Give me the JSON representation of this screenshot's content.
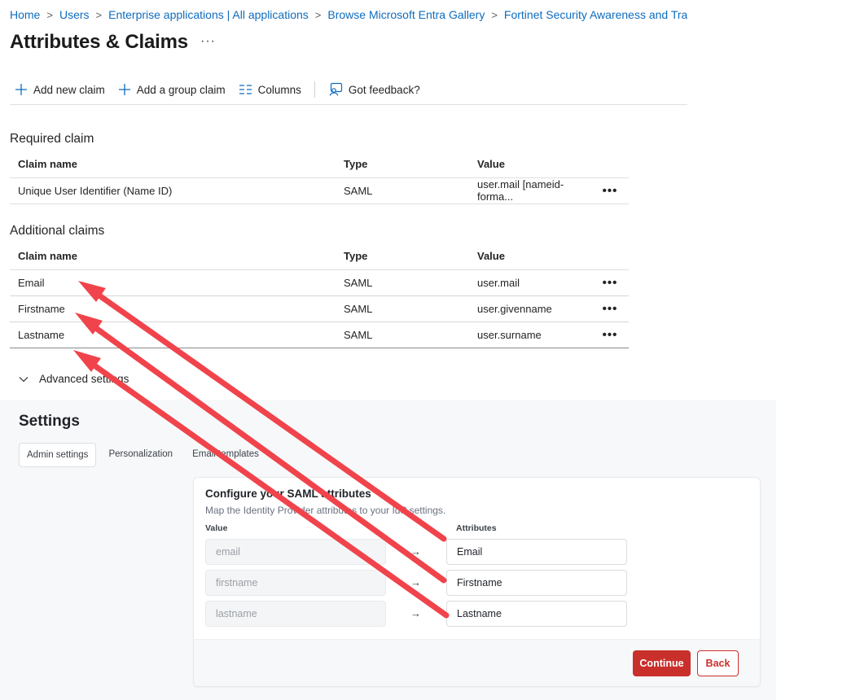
{
  "breadcrumb": [
    {
      "label": "Home"
    },
    {
      "label": "Users"
    },
    {
      "label": "Enterprise applications | All applications"
    },
    {
      "label": "Browse Microsoft Entra Gallery"
    },
    {
      "label": "Fortinet Security Awareness and Trainin"
    }
  ],
  "page": {
    "title": "Attributes & Claims",
    "more": "···"
  },
  "toolbar": {
    "add_new_claim": "Add new claim",
    "add_group_claim": "Add a group claim",
    "columns": "Columns",
    "feedback": "Got feedback?"
  },
  "required": {
    "title": "Required claim",
    "headers": {
      "name": "Claim name",
      "type": "Type",
      "value": "Value"
    },
    "rows": [
      {
        "name": "Unique User Identifier (Name ID)",
        "type": "SAML",
        "value": "user.mail [nameid-forma...",
        "more": "•••"
      }
    ]
  },
  "additional": {
    "title": "Additional claims",
    "headers": {
      "name": "Claim name",
      "type": "Type",
      "value": "Value"
    },
    "rows": [
      {
        "name": "Email",
        "type": "SAML",
        "value": "user.mail",
        "more": "•••"
      },
      {
        "name": "Firstname",
        "type": "SAML",
        "value": "user.givenname",
        "more": "•••"
      },
      {
        "name": "Lastname",
        "type": "SAML",
        "value": "user.surname",
        "more": "•••"
      }
    ]
  },
  "advanced": {
    "label": "Advanced settings"
  },
  "settings": {
    "title": "Settings",
    "tabs": [
      "Admin settings",
      "Personalization",
      "Email templates"
    ],
    "card": {
      "title": "Configure your SAML attributes",
      "subtitle": "Map the Identity Provider attributes to your IdP settings.",
      "value_label": "Value",
      "attributes_label": "Attributes",
      "rows": [
        {
          "value": "email",
          "attribute": "Email"
        },
        {
          "value": "firstname",
          "attribute": "Firstname"
        },
        {
          "value": "lastname",
          "attribute": "Lastname"
        }
      ],
      "arrow": "→",
      "continue": "Continue",
      "back": "Back"
    }
  },
  "colors": {
    "link": "#0f6cbd",
    "annotation_arrow": "#f0434b",
    "continue_button": "#c9302c"
  }
}
